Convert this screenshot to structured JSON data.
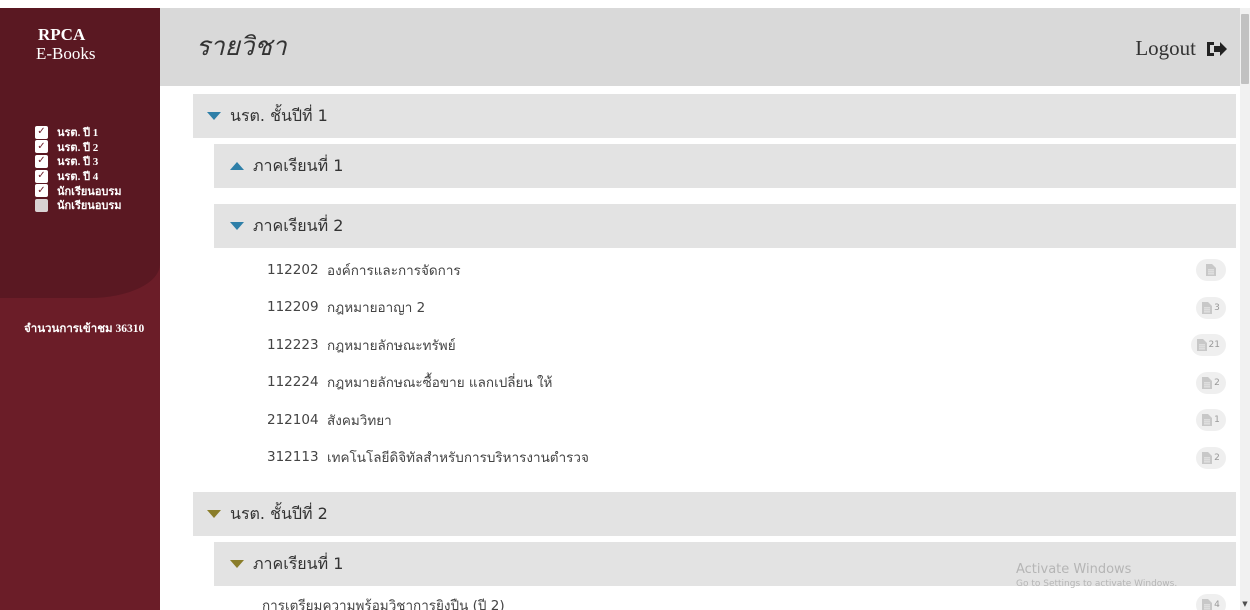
{
  "sidebar": {
    "brand_line1": "RPCA",
    "brand_line2": "E-Books",
    "filters": [
      {
        "label": "นรต. ปี 1",
        "checked": true
      },
      {
        "label": "นรต. ปี 2",
        "checked": true
      },
      {
        "label": "นรต. ปี 3",
        "checked": true
      },
      {
        "label": "นรต. ปี 4",
        "checked": true
      },
      {
        "label": "นักเรียนอบรม",
        "checked": true
      },
      {
        "label": "นักเรียนอบรม",
        "checked": false
      }
    ],
    "visits": "จำนวนการเข้าชม 36310"
  },
  "header": {
    "title": "รายวิชา",
    "logout_label": "Logout"
  },
  "years": [
    {
      "label": "นรต. ชั้นปีที่ 1",
      "expanded": true,
      "semesters": [
        {
          "label": "ภาคเรียนที่ 1",
          "expanded": false,
          "courses": []
        },
        {
          "label": "ภาคเรียนที่ 2",
          "expanded": true,
          "courses": [
            {
              "code": "112202",
              "name": "องค์การและการจัดการ",
              "count": ""
            },
            {
              "code": "112209",
              "name": "กฎหมายอาญา 2",
              "count": "3"
            },
            {
              "code": "112223",
              "name": "กฎหมายลักษณะทรัพย์",
              "count": "21"
            },
            {
              "code": "112224",
              "name": "กฎหมายลักษณะซื้อขาย แลกเปลี่ยน ให้",
              "count": "2"
            },
            {
              "code": "212104",
              "name": "สังคมวิทยา",
              "count": "1"
            },
            {
              "code": "312113",
              "name": "เทคโนโลยีดิจิทัลสำหรับการบริหารงานตำรวจ",
              "count": "2"
            }
          ]
        }
      ]
    },
    {
      "label": "นรต. ชั้นปีที่ 2",
      "expanded": true,
      "semesters": [
        {
          "label": "ภาคเรียนที่ 1",
          "expanded": true,
          "courses": [
            {
              "code": "",
              "name": "การเตรียมความพร้อมวิชาการยิงปืน (ปี 2)",
              "count": "4"
            }
          ]
        }
      ]
    }
  ],
  "watermark": {
    "line1": "Activate Windows",
    "line2": "Go to Settings to activate Windows."
  },
  "colors": {
    "sidebar_bg": "#6b1d28",
    "sidebar_top": "#5a1822",
    "year1_accent": "#2e7fa8",
    "year2_accent": "#8a7d2a",
    "header_bg": "#d9d9d9"
  },
  "icons": {
    "logout": "sign-out-icon",
    "course": "file-text-icon",
    "expand": "triangle-down-icon",
    "collapse": "triangle-up-icon"
  }
}
